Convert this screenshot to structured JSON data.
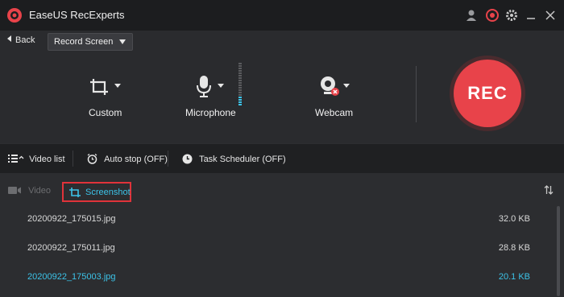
{
  "app": {
    "title": "EaseUS RecExperts"
  },
  "nav": {
    "back_label": "Back",
    "mode_value": "Record Screen"
  },
  "sources": {
    "custom": "Custom",
    "microphone": "Microphone",
    "webcam": "Webcam"
  },
  "rec_button": "REC",
  "toolbar": {
    "video_list": "Video list",
    "auto_stop": "Auto stop (OFF)",
    "task_scheduler": "Task Scheduler (OFF)"
  },
  "tabs": {
    "video": "Video",
    "screenshot": "Screenshot"
  },
  "files": [
    {
      "name": "20200922_175015.jpg",
      "size": "32.0 KB"
    },
    {
      "name": "20200922_175011.jpg",
      "size": "28.8 KB"
    },
    {
      "name": "20200922_175003.jpg",
      "size": "20.1 KB"
    }
  ],
  "colors": {
    "accent": "#3cc3e8",
    "rec": "#e8434a",
    "highlight_border": "#e0333a"
  }
}
